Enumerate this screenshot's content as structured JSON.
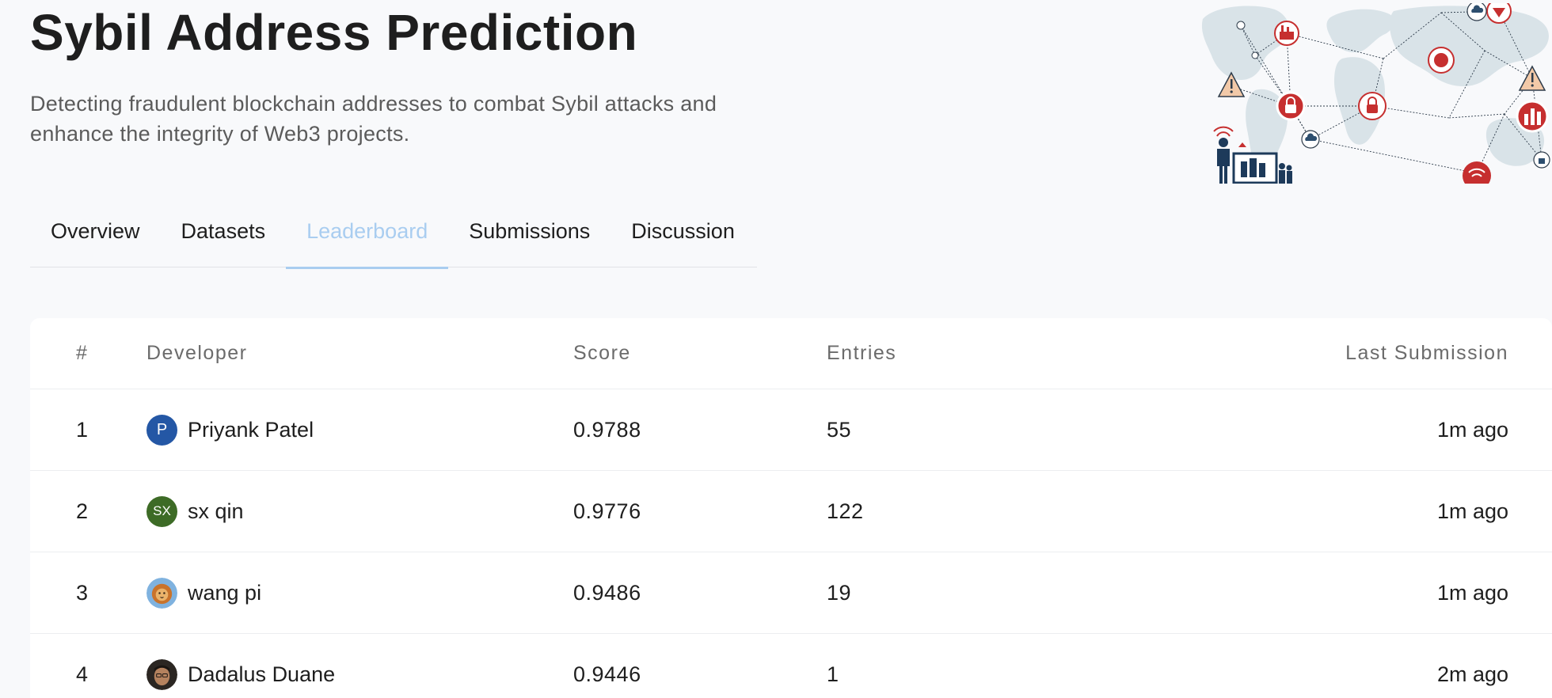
{
  "header": {
    "title": "Sybil Address Prediction",
    "description": "Detecting fraudulent blockchain addresses to combat Sybil attacks and enhance the integrity of Web3 projects."
  },
  "tabs": [
    {
      "label": "Overview"
    },
    {
      "label": "Datasets"
    },
    {
      "label": "Leaderboard",
      "active": true
    },
    {
      "label": "Submissions"
    },
    {
      "label": "Discussion"
    }
  ],
  "leaderboard": {
    "columns": {
      "rank": "#",
      "developer": "Developer",
      "score": "Score",
      "entries": "Entries",
      "last": "Last Submission"
    },
    "rows": [
      {
        "rank": "1",
        "avatar_text": "P",
        "avatar_color": "#2457a5",
        "developer": "Priyank Patel",
        "score": "0.9788",
        "entries": "55",
        "last": "1m ago"
      },
      {
        "rank": "2",
        "avatar_text": "SX",
        "avatar_color": "#3d6b26",
        "developer": "sx qin",
        "score": "0.9776",
        "entries": "122",
        "last": "1m ago"
      },
      {
        "rank": "3",
        "avatar_text": "",
        "avatar_icon": "lion-avatar-icon",
        "developer": "wang pi",
        "score": "0.9486",
        "entries": "19",
        "last": "1m ago"
      },
      {
        "rank": "4",
        "avatar_text": "",
        "avatar_icon": "photo-avatar-icon",
        "developer": "Dadalus Duane",
        "score": "0.9446",
        "entries": "1",
        "last": "2m ago"
      }
    ]
  },
  "colors": {
    "accent_tab": "#a9cdf0",
    "hero_red": "#c62f2f",
    "hero_navy": "#1d3a5a"
  }
}
